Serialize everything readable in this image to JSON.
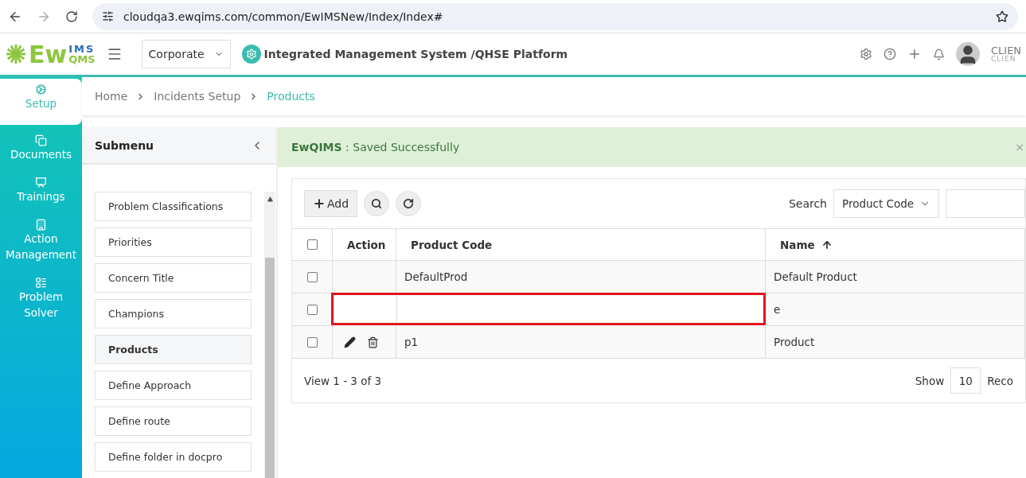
{
  "browser": {
    "url": "cloudqa3.ewqims.com/common/EwIMSNew/Index/Index#"
  },
  "header": {
    "logo_main": "Ew",
    "logo_top": "IMS",
    "logo_bottom": "QMS",
    "org_select": "Corporate",
    "title": "Integrated Management System /QHSE Platform",
    "user_name": "CLIEN",
    "user_sub": "CLIEN"
  },
  "nav": [
    {
      "kind": "setup",
      "label": "Setup",
      "selected": true
    },
    {
      "kind": "documents",
      "label": "Documents",
      "selected": false
    },
    {
      "kind": "trainings",
      "label": "Trainings",
      "selected": false
    },
    {
      "kind": "action",
      "label": "Action Management",
      "selected": false
    },
    {
      "kind": "solver",
      "label": "Problem Solver",
      "selected": false
    }
  ],
  "breadcrumb": [
    {
      "label": "Home",
      "current": false
    },
    {
      "label": "Incidents Setup",
      "current": false
    },
    {
      "label": "Products",
      "current": true
    }
  ],
  "submenu": {
    "title": "Submenu",
    "items": [
      {
        "label": "Problem Classifications",
        "selected": false
      },
      {
        "label": "Priorities",
        "selected": false
      },
      {
        "label": "Concern Title",
        "selected": false
      },
      {
        "label": "Champions",
        "selected": false
      },
      {
        "label": "Products",
        "selected": true
      },
      {
        "label": "Define Approach",
        "selected": false
      },
      {
        "label": "Define route",
        "selected": false
      },
      {
        "label": "Define folder in docpro",
        "selected": false
      }
    ]
  },
  "alert": {
    "message": "**EwQIMS** : Saved Successfully",
    "close": "×"
  },
  "toolbar": {
    "add_label": "Add",
    "search_label": "Search",
    "search_by": "Product Code"
  },
  "table": {
    "select_all_checked": false,
    "columns": [
      {
        "label": "Action",
        "sorted": false
      },
      {
        "label": "Product Code",
        "sorted": false
      },
      {
        "label": "Name",
        "sorted": true
      }
    ],
    "rows": [
      {
        "checked": false,
        "actions": false,
        "highlighted": false,
        "code": "DefaultProd",
        "name": "Default Product"
      },
      {
        "checked": false,
        "actions": false,
        "highlighted": true,
        "name": "e"
      },
      {
        "checked": false,
        "actions": true,
        "highlighted": false,
        "code": "p1",
        "name": "Product"
      }
    ]
  },
  "footer": {
    "view": "View 1 - 3 of 3",
    "show_label": "Show",
    "page_size": "10",
    "records_label": "Reco"
  }
}
